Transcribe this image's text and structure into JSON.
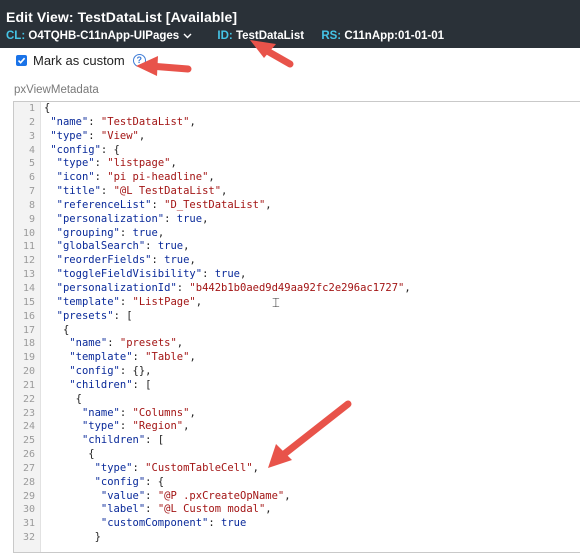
{
  "header": {
    "title": "Edit View: TestDataList [Available]",
    "cl_key": "CL:",
    "cl_value": "O4TQHB-C11nApp-UIPages",
    "id_key": "ID:",
    "id_value": "TestDataList",
    "rs_key": "RS:",
    "rs_value": "C11nApp:01-01-01"
  },
  "checkbox": {
    "label": "Mark as custom",
    "checked": true,
    "help": "?"
  },
  "section_label": "pxViewMetadata",
  "editor": {
    "lines": [
      {
        "n": "1",
        "text": "{"
      },
      {
        "n": "2",
        "text": " \"name\": \"TestDataList\","
      },
      {
        "n": "3",
        "text": " \"type\": \"View\","
      },
      {
        "n": "4",
        "text": " \"config\": {"
      },
      {
        "n": "5",
        "text": "  \"type\": \"listpage\","
      },
      {
        "n": "6",
        "text": "  \"icon\": \"pi pi-headline\","
      },
      {
        "n": "7",
        "text": "  \"title\": \"@L TestDataList\","
      },
      {
        "n": "8",
        "text": "  \"referenceList\": \"D_TestDataList\","
      },
      {
        "n": "9",
        "text": "  \"personalization\": true,"
      },
      {
        "n": "10",
        "text": "  \"grouping\": true,"
      },
      {
        "n": "11",
        "text": "  \"globalSearch\": true,"
      },
      {
        "n": "12",
        "text": "  \"reorderFields\": true,"
      },
      {
        "n": "13",
        "text": "  \"toggleFieldVisibility\": true,"
      },
      {
        "n": "14",
        "text": "  \"personalizationId\": \"b442b1b0aed9d49aa92fc2e296ac1727\","
      },
      {
        "n": "15",
        "text": "  \"template\": \"ListPage\","
      },
      {
        "n": "16",
        "text": "  \"presets\": ["
      },
      {
        "n": "17",
        "text": "   {"
      },
      {
        "n": "18",
        "text": "    \"name\": \"presets\","
      },
      {
        "n": "19",
        "text": "    \"template\": \"Table\","
      },
      {
        "n": "20",
        "text": "    \"config\": {},"
      },
      {
        "n": "21",
        "text": "    \"children\": ["
      },
      {
        "n": "22",
        "text": "     {"
      },
      {
        "n": "23",
        "text": "      \"name\": \"Columns\","
      },
      {
        "n": "24",
        "text": "      \"type\": \"Region\","
      },
      {
        "n": "25",
        "text": "      \"children\": ["
      },
      {
        "n": "26",
        "text": "       {"
      },
      {
        "n": "27",
        "text": "        \"type\": \"CustomTableCell\","
      },
      {
        "n": "28",
        "text": "        \"config\": {"
      },
      {
        "n": "29",
        "text": "         \"value\": \"@P .pxCreateOpName\","
      },
      {
        "n": "30",
        "text": "         \"label\": \"@L Custom modal\","
      },
      {
        "n": "31",
        "text": "         \"customComponent\": true"
      },
      {
        "n": "32",
        "text": "        }"
      }
    ]
  },
  "colors": {
    "header_bg": "#2a3138",
    "meta_key": "#45c4e6",
    "arrow": "#e8534a",
    "checkbox": "#1a73e8"
  }
}
